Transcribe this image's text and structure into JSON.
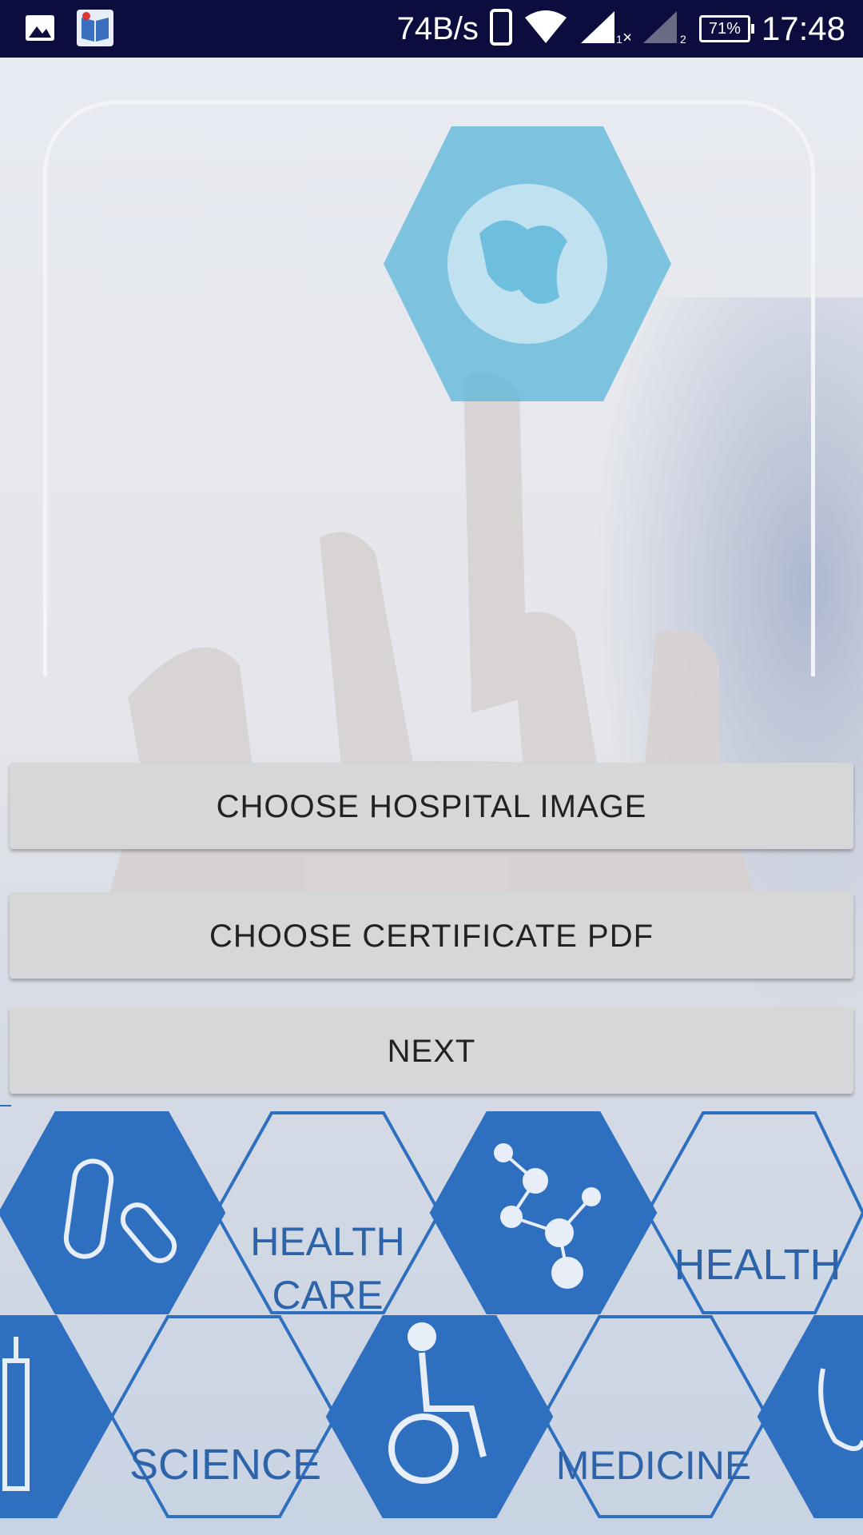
{
  "status_bar": {
    "net_speed": "74B/s",
    "battery": "71%",
    "time": "17:48",
    "icons": [
      "gallery-icon",
      "book-app-icon",
      "phone-icon",
      "wifi-icon",
      "signal-sim1-icon",
      "signal-sim2-icon",
      "battery-icon"
    ]
  },
  "buttons": {
    "choose_image": "CHOOSE HOSPITAL IMAGE",
    "choose_pdf": "CHOOSE CERTIFICATE PDF",
    "next": "NEXT"
  },
  "background": {
    "hex_labels": {
      "health_care_1": "HEALTH",
      "health_care_2": "CARE",
      "health": "HEALTH",
      "science": "SCIENCE",
      "medicine": "MEDICINE"
    },
    "colors": {
      "hex_blue": "#2f6fbf",
      "frame": "#f3f4f7",
      "status_bar": "#0c0c3f"
    }
  }
}
